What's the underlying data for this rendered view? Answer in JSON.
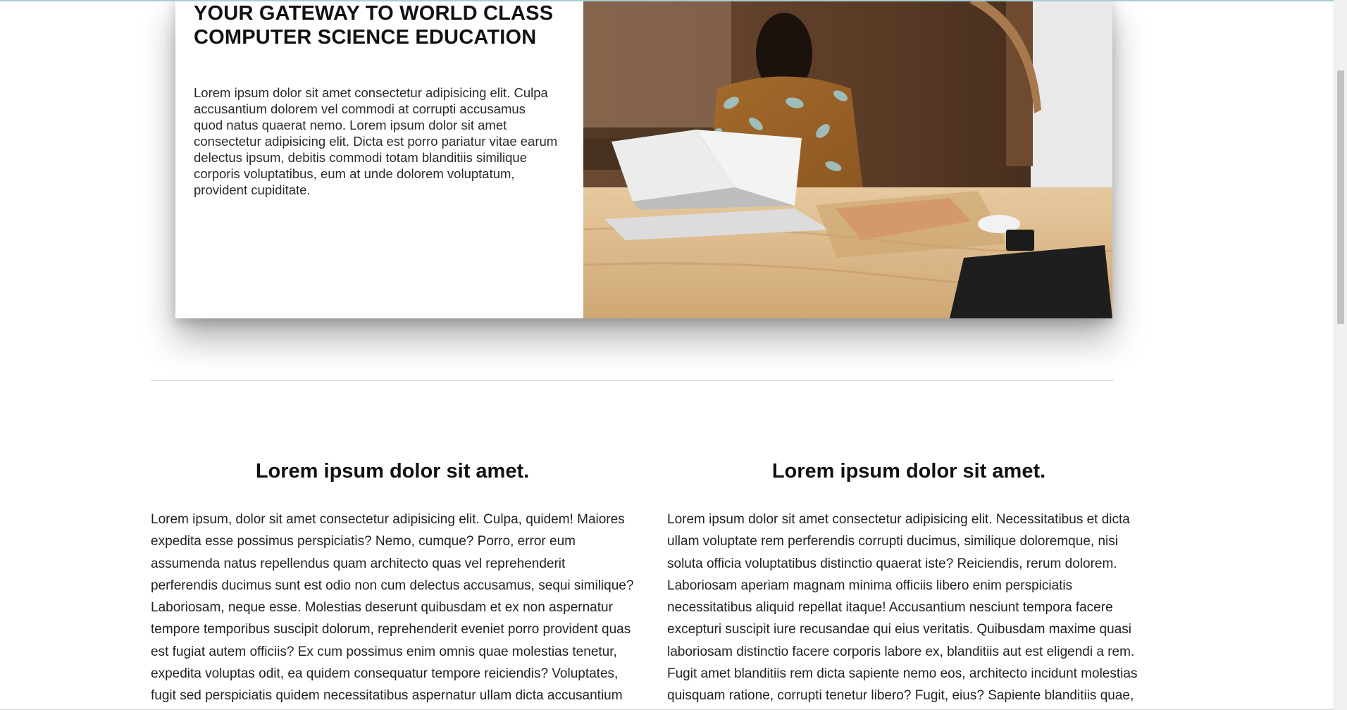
{
  "hero": {
    "title": "YOUR GATEWAY TO WORLD CLASS COMPUTER SCIENCE EDUCATION",
    "paragraph": "Lorem ipsum dolor sit amet consectetur adipisicing elit. Culpa accusantium dolorem vel commodi at corrupti accusamus quod natus quaerat nemo. Lorem ipsum dolor sit amet consectetur adipisicing elit. Dicta est porro pariatur vitae earum delectus ipsum, debitis commodi totam blanditiis similique corporis voluptatibus, eum at unde dolorem voluptatum, provident cupiditate."
  },
  "features": [
    {
      "heading": "Lorem ipsum dolor sit amet.",
      "body": "Lorem ipsum, dolor sit amet consectetur adipisicing elit. Culpa, quidem! Maiores expedita esse possimus perspiciatis? Nemo, cumque? Porro, error eum assumenda natus repellendus quam architecto quas vel reprehenderit perferendis ducimus sunt est odio non cum delectus accusamus, sequi similique? Laboriosam, neque esse. Molestias deserunt quibusdam et ex non aspernatur tempore temporibus suscipit dolorum, reprehenderit eveniet porro provident quas est fugiat autem officiis? Ex cum possimus enim omnis quae molestias tenetur, expedita voluptas odit, ea quidem consequatur tempore reiciendis? Voluptates, fugit sed perspiciatis quidem necessitatibus aspernatur ullam dicta accusantium ut esse maxime molestiae inventore"
    },
    {
      "heading": "Lorem ipsum dolor sit amet.",
      "body": "Lorem ipsum dolor sit amet consectetur adipisicing elit. Necessitatibus et dicta ullam voluptate rem perferendis corrupti ducimus, similique doloremque, nisi soluta officia voluptatibus distinctio quaerat iste? Reiciendis, rerum dolorem. Laboriosam aperiam magnam minima officiis libero enim perspiciatis necessitatibus aliquid repellat itaque! Accusantium nesciunt tempora facere excepturi suscipit iure recusandae qui eius veritatis. Quibusdam maxime quasi laboriosam distinctio facere corporis labore ex, blanditiis aut est eligendi a rem. Fugit amet blanditiis rem dicta sapiente nemo eos, architecto incidunt molestias quisquam ratione, corrupti tenetur libero? Fugit, eius? Sapiente blanditiis quae, voluptatibus voluptatum"
    }
  ]
}
